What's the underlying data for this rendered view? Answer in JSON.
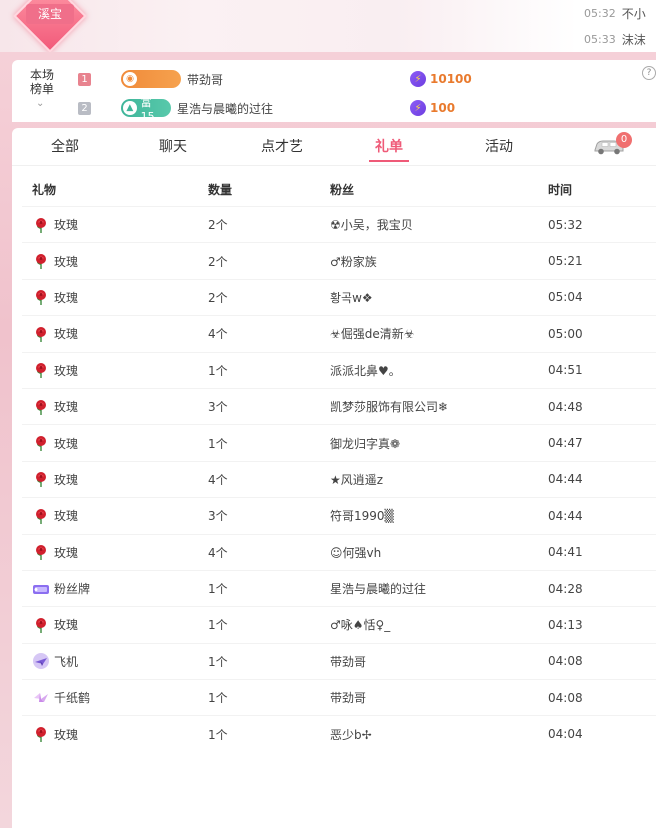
{
  "top": {
    "host_badge": "溪宝",
    "chat": [
      {
        "time": "05:32",
        "name": "不小"
      },
      {
        "time": "05:33",
        "name": "沫沫"
      }
    ]
  },
  "ranking": {
    "title": "本场榜单",
    "entries": [
      {
        "rank": "1",
        "level_badge": "",
        "user": "带劲哥",
        "score": "10100"
      },
      {
        "rank": "2",
        "level_badge": "富15",
        "user": "星浩与晨曦的过往",
        "score": "100"
      }
    ]
  },
  "tabs": [
    {
      "label": "全部",
      "active": false
    },
    {
      "label": "聊天",
      "active": false
    },
    {
      "label": "点才艺",
      "active": false
    },
    {
      "label": "礼单",
      "active": true
    },
    {
      "label": "活动",
      "active": false
    }
  ],
  "car_badge": "0",
  "table": {
    "headers": {
      "gift": "礼物",
      "qty": "数量",
      "fan": "粉丝",
      "time": "时间"
    },
    "rows": [
      {
        "icon": "rose-icon",
        "gift": "玫瑰",
        "qty": "2个",
        "fan": "☢小吴，我宝贝",
        "time": "05:32"
      },
      {
        "icon": "rose-icon",
        "gift": "玫瑰",
        "qty": "2个",
        "fan": "♂粉家族",
        "time": "05:21"
      },
      {
        "icon": "rose-icon",
        "gift": "玫瑰",
        "qty": "2个",
        "fan": "황곡w❖",
        "time": "05:04"
      },
      {
        "icon": "rose-icon",
        "gift": "玫瑰",
        "qty": "4个",
        "fan": "☣倔强de清新☣",
        "time": "05:00"
      },
      {
        "icon": "rose-icon",
        "gift": "玫瑰",
        "qty": "1个",
        "fan": "派派北鼻♥。",
        "time": "04:51"
      },
      {
        "icon": "rose-icon",
        "gift": "玫瑰",
        "qty": "3个",
        "fan": "凯梦莎服饰有限公司❄",
        "time": "04:48"
      },
      {
        "icon": "rose-icon",
        "gift": "玫瑰",
        "qty": "1个",
        "fan": "御龙归字真❁",
        "time": "04:47"
      },
      {
        "icon": "rose-icon",
        "gift": "玫瑰",
        "qty": "4个",
        "fan": "★风逍遥z",
        "time": "04:44"
      },
      {
        "icon": "rose-icon",
        "gift": "玫瑰",
        "qty": "3个",
        "fan": "符哥1990▒",
        "time": "04:44"
      },
      {
        "icon": "rose-icon",
        "gift": "玫瑰",
        "qty": "4个",
        "fan": "☺何强vh",
        "time": "04:41"
      },
      {
        "icon": "fan-badge-icon",
        "gift": "粉丝牌",
        "qty": "1个",
        "fan": "星浩与晨曦的过往",
        "time": "04:28"
      },
      {
        "icon": "rose-icon",
        "gift": "玫瑰",
        "qty": "1个",
        "fan": "♂咏♠恬♀_",
        "time": "04:13"
      },
      {
        "icon": "airplane-icon",
        "gift": "飞机",
        "qty": "1个",
        "fan": "带劲哥",
        "time": "04:08"
      },
      {
        "icon": "paper-crane-icon",
        "gift": "千纸鹤",
        "qty": "1个",
        "fan": "带劲哥",
        "time": "04:08"
      },
      {
        "icon": "rose-icon",
        "gift": "玫瑰",
        "qty": "1个",
        "fan": "恶少b✢",
        "time": "04:04"
      }
    ]
  }
}
